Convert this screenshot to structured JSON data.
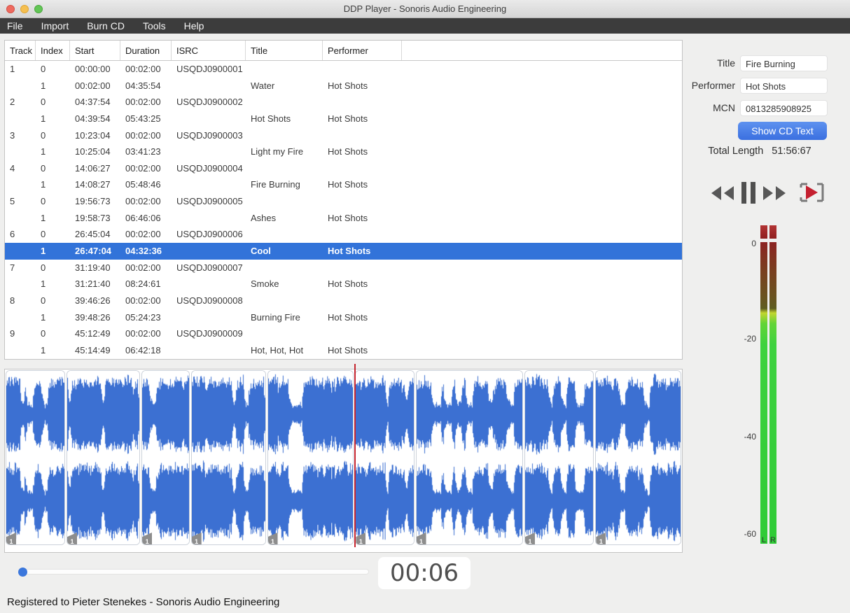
{
  "window": {
    "title": "DDP Player - Sonoris Audio Engineering"
  },
  "menu": {
    "items": [
      "File",
      "Import",
      "Burn CD",
      "Tools",
      "Help"
    ]
  },
  "table": {
    "columns": [
      "Track",
      "Index",
      "Start",
      "Duration",
      "ISRC",
      "Title",
      "Performer"
    ],
    "rows": [
      {
        "track": "1",
        "index": "0",
        "start": "00:00:00",
        "duration": "00:02:00",
        "isrc": "USQDJ0900001",
        "title": "",
        "performer": "",
        "selected": false
      },
      {
        "track": "",
        "index": "1",
        "start": "00:02:00",
        "duration": "04:35:54",
        "isrc": "",
        "title": "Water",
        "performer": "Hot Shots",
        "selected": false
      },
      {
        "track": "2",
        "index": "0",
        "start": "04:37:54",
        "duration": "00:02:00",
        "isrc": "USQDJ0900002",
        "title": "",
        "performer": "",
        "selected": false
      },
      {
        "track": "",
        "index": "1",
        "start": "04:39:54",
        "duration": "05:43:25",
        "isrc": "",
        "title": "Hot Shots",
        "performer": "Hot Shots",
        "selected": false
      },
      {
        "track": "3",
        "index": "0",
        "start": "10:23:04",
        "duration": "00:02:00",
        "isrc": "USQDJ0900003",
        "title": "",
        "performer": "",
        "selected": false
      },
      {
        "track": "",
        "index": "1",
        "start": "10:25:04",
        "duration": "03:41:23",
        "isrc": "",
        "title": "Light my Fire",
        "performer": "Hot Shots",
        "selected": false
      },
      {
        "track": "4",
        "index": "0",
        "start": "14:06:27",
        "duration": "00:02:00",
        "isrc": "USQDJ0900004",
        "title": "",
        "performer": "",
        "selected": false
      },
      {
        "track": "",
        "index": "1",
        "start": "14:08:27",
        "duration": "05:48:46",
        "isrc": "",
        "title": "Fire Burning",
        "performer": "Hot Shots",
        "selected": false
      },
      {
        "track": "5",
        "index": "0",
        "start": "19:56:73",
        "duration": "00:02:00",
        "isrc": "USQDJ0900005",
        "title": "",
        "performer": "",
        "selected": false
      },
      {
        "track": "",
        "index": "1",
        "start": "19:58:73",
        "duration": "06:46:06",
        "isrc": "",
        "title": "Ashes",
        "performer": "Hot Shots",
        "selected": false
      },
      {
        "track": "6",
        "index": "0",
        "start": "26:45:04",
        "duration": "00:02:00",
        "isrc": "USQDJ0900006",
        "title": "",
        "performer": "",
        "selected": false
      },
      {
        "track": "",
        "index": "1",
        "start": "26:47:04",
        "duration": "04:32:36",
        "isrc": "",
        "title": "Cool",
        "performer": "Hot Shots",
        "selected": true
      },
      {
        "track": "7",
        "index": "0",
        "start": "31:19:40",
        "duration": "00:02:00",
        "isrc": "USQDJ0900007",
        "title": "",
        "performer": "",
        "selected": false
      },
      {
        "track": "",
        "index": "1",
        "start": "31:21:40",
        "duration": "08:24:61",
        "isrc": "",
        "title": "Smoke",
        "performer": "Hot Shots",
        "selected": false
      },
      {
        "track": "8",
        "index": "0",
        "start": "39:46:26",
        "duration": "00:02:00",
        "isrc": "USQDJ0900008",
        "title": "",
        "performer": "",
        "selected": false
      },
      {
        "track": "",
        "index": "1",
        "start": "39:48:26",
        "duration": "05:24:23",
        "isrc": "",
        "title": "Burning Fire",
        "performer": "Hot Shots",
        "selected": false
      },
      {
        "track": "9",
        "index": "0",
        "start": "45:12:49",
        "duration": "00:02:00",
        "isrc": "USQDJ0900009",
        "title": "",
        "performer": "",
        "selected": false
      },
      {
        "track": "",
        "index": "1",
        "start": "45:14:49",
        "duration": "06:42:18",
        "isrc": "",
        "title": "Hot, Hot, Hot",
        "performer": "Hot Shots",
        "selected": false
      }
    ]
  },
  "side": {
    "title_label": "Title",
    "title_value": "Fire Burning",
    "performer_label": "Performer",
    "performer_value": "Hot Shots",
    "mcn_label": "MCN",
    "mcn_value": "0813285908925",
    "show_cd_text_button": "Show CD Text",
    "total_length_label": "Total Length",
    "total_length_value": "51:56:67"
  },
  "transport": {
    "buttons": [
      "rewind",
      "pause",
      "fast-forward",
      "play-through"
    ]
  },
  "meters": {
    "scale": [
      "0",
      "-20",
      "-40",
      "-60"
    ],
    "channels": [
      "L",
      "R"
    ]
  },
  "waveform": {
    "segments": [
      {
        "marker": "1",
        "duration_sec": 278
      },
      {
        "marker": "1",
        "duration_sec": 345
      },
      {
        "marker": "1",
        "duration_sec": 223
      },
      {
        "marker": "1",
        "duration_sec": 351
      },
      {
        "marker": "1",
        "duration_sec": 408
      },
      {
        "marker": "1",
        "duration_sec": 275
      },
      {
        "marker": "1",
        "duration_sec": 507
      },
      {
        "marker": "1",
        "duration_sec": 326
      },
      {
        "marker": "1",
        "duration_sec": 404
      }
    ]
  },
  "player": {
    "time_display": "00:06"
  },
  "status": {
    "text": "Registered to Pieter Stenekes - Sonoris Audio Engineering"
  },
  "colors": {
    "selection_blue": "#3273d9",
    "waveform_blue": "#3c70d2",
    "playhead_red": "#c5252f",
    "button_blue": "#3a6fe0",
    "meter_green": "#2fcb36",
    "meter_clip_red": "#8f1f1f"
  }
}
